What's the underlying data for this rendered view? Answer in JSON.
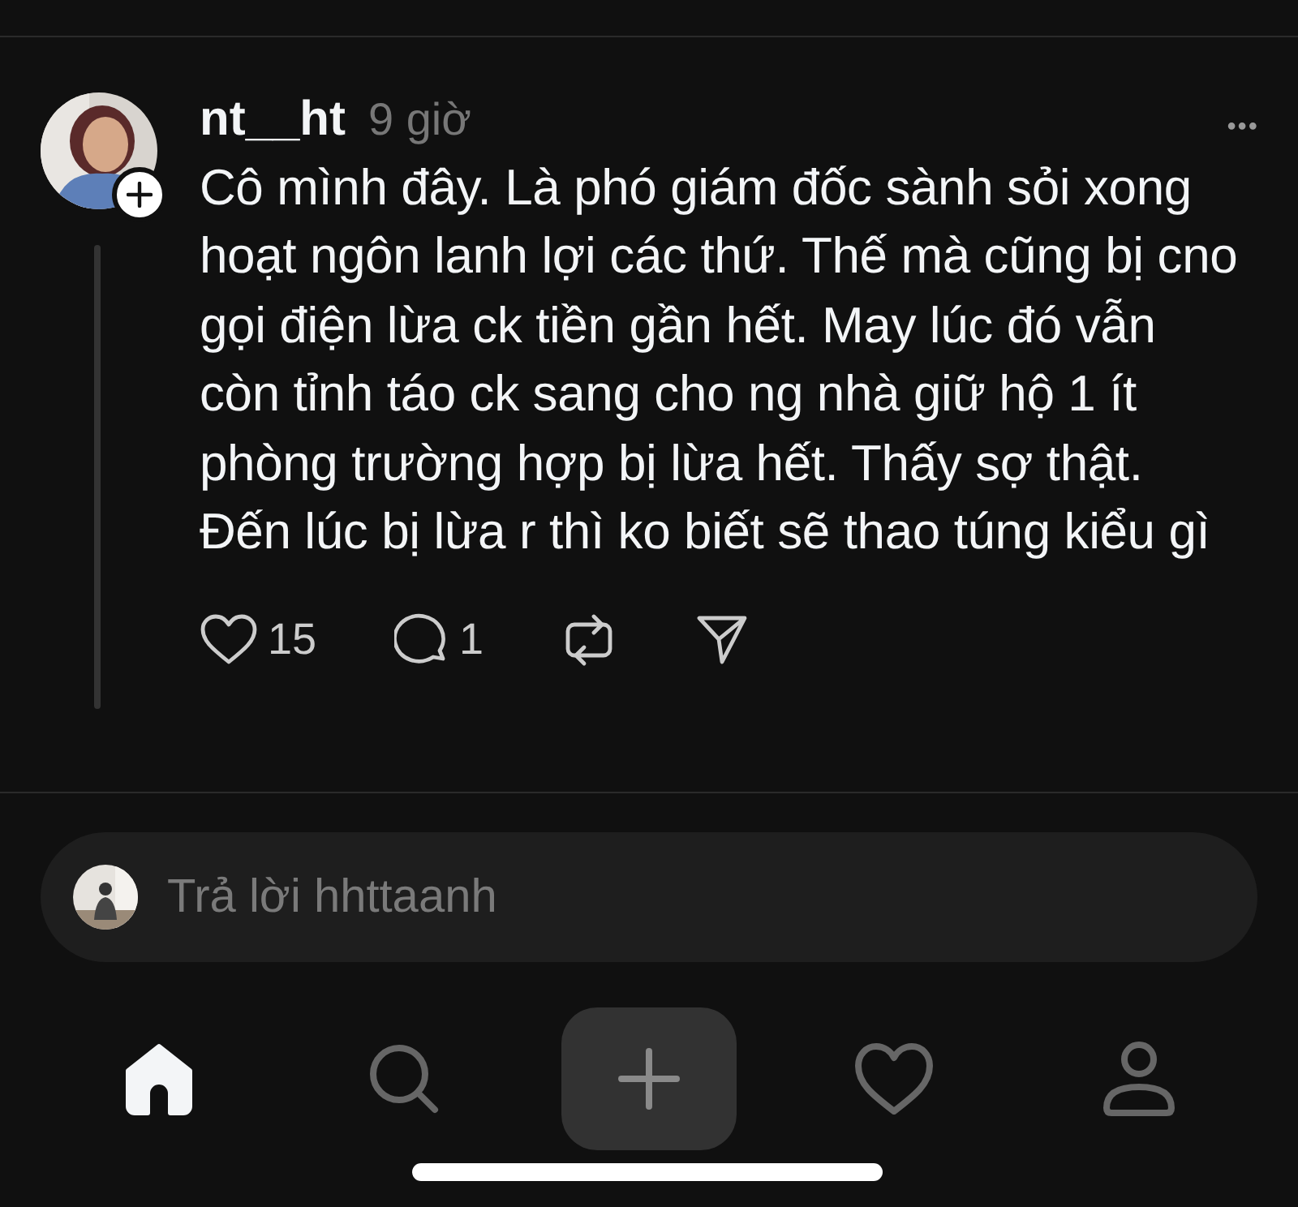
{
  "post": {
    "author": "nt__ht",
    "time": "9 giờ",
    "more": "•••",
    "text": "Cô mình đây. Là phó giám đốc sành sỏi xong hoạt ngôn lanh lợi các thứ. Thế mà cũng bị cno gọi điện lừa ck tiền gần hết. May lúc đó vẫn còn tỉnh táo ck sang cho ng nhà giữ hộ 1 ít phòng trường hợp bị lừa hết. Thấy sợ thật. Đến lúc bị lừa r thì ko biết sẽ thao túng kiểu gì",
    "actions": [
      {
        "kind": "like",
        "count": "15"
      },
      {
        "kind": "comment",
        "count": "1"
      },
      {
        "kind": "repost"
      },
      {
        "kind": "share"
      }
    ]
  },
  "reply": {
    "placeholder": "Trả lời hhttaanh"
  },
  "nav": [
    {
      "kind": "home",
      "selected": true
    },
    {
      "kind": "search",
      "selected": false
    },
    {
      "kind": "compose",
      "selected": false
    },
    {
      "kind": "activity",
      "selected": false
    },
    {
      "kind": "profile",
      "selected": false
    }
  ]
}
